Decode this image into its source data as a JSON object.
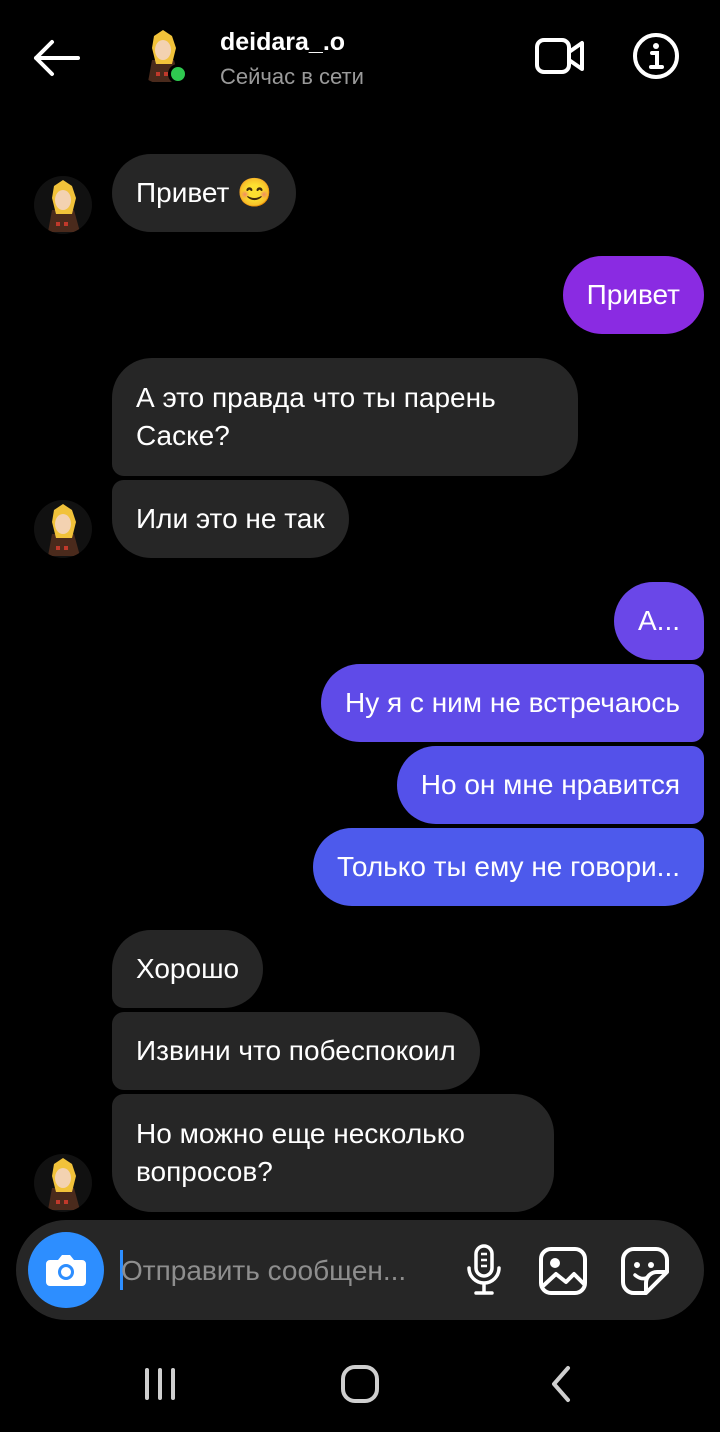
{
  "header": {
    "username": "deidara_.o",
    "status": "Сейчас в сети",
    "icons": {
      "back": "arrow-left-icon",
      "video": "video-camera-icon",
      "info": "info-icon"
    }
  },
  "messages": [
    {
      "side": "in",
      "text": "Привет 😊"
    },
    {
      "side": "out",
      "text": "Привет"
    },
    {
      "side": "in",
      "text": "А это правда что ты парень\nСаске?"
    },
    {
      "side": "in",
      "text": "Или это не так"
    },
    {
      "side": "out",
      "text": "А..."
    },
    {
      "side": "out",
      "text": "Ну я с ним не встречаюсь"
    },
    {
      "side": "out",
      "text": "Но он мне нравится"
    },
    {
      "side": "out",
      "text": "Только ты ему не говори..."
    },
    {
      "side": "in",
      "text": "Хорошо"
    },
    {
      "side": "in",
      "text": "Извини что побеспокоил"
    },
    {
      "side": "in",
      "text": "Но можно еще несколько\nвопросов?"
    }
  ],
  "composer": {
    "placeholder": "Отправить сообщен...",
    "icons": {
      "camera": "camera-icon",
      "mic": "microphone-icon",
      "gallery": "image-icon",
      "sticker": "sticker-icon"
    }
  },
  "colors": {
    "incoming_bubble": "#262626",
    "outgoing_gradient": [
      "#8a2be2",
      "#7b3ae6",
      "#6a47e8",
      "#5f4be8",
      "#5451ea",
      "#4f56eb",
      "#4d5aec"
    ],
    "accent_blue": "#2d8eff",
    "online_green": "#2fc950"
  },
  "navbar": {
    "icons": [
      "recent-apps-icon",
      "home-icon",
      "back-nav-icon"
    ]
  }
}
